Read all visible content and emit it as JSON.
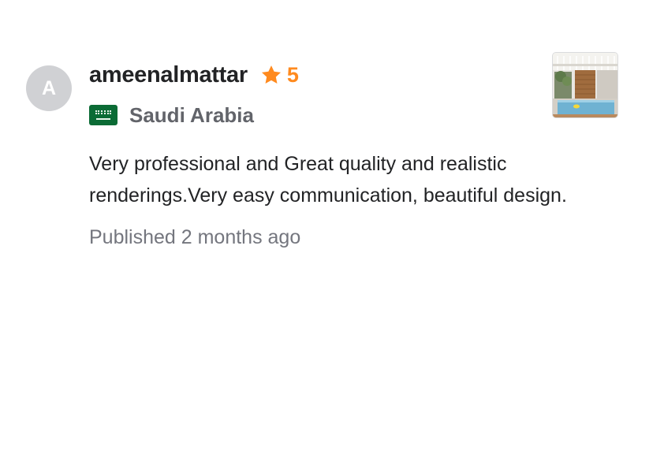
{
  "review": {
    "avatar_initial": "A",
    "username": "ameenalmattar",
    "rating": "5",
    "country": "Saudi Arabia",
    "text": "Very professional and Great quality and realistic renderings.Very easy communication, beautiful design.",
    "published": "Published 2 months ago"
  },
  "icons": {
    "rating": "star-icon",
    "country_flag": "saudi-arabia-flag-icon"
  },
  "colors": {
    "star": "#ff8a1e",
    "avatar_bg": "#d0d1d4",
    "flag_green": "#0b6b35",
    "text_primary": "#222325",
    "text_secondary": "#62646a",
    "text_muted": "#74767e"
  }
}
